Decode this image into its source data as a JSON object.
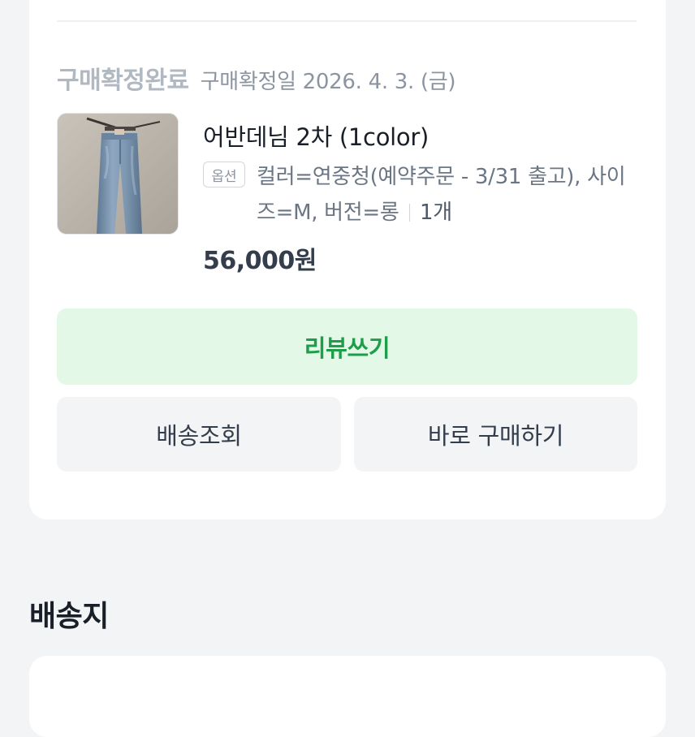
{
  "order": {
    "status_label": "구매확정완료",
    "confirm_date": "구매확정일 2026. 4. 3. (금)",
    "product": {
      "name": "어반데님 2차 (1color)",
      "image": "jeans-photo",
      "option_badge": "옵션",
      "option_text": "컬러=연중청(예약주문 - 3/31 출고), 사이즈=M, 버전=롱",
      "quantity": "1개",
      "price": "56,000원"
    },
    "buttons": {
      "review": "리뷰쓰기",
      "track_shipping": "배송조회",
      "buy_again": "바로 구매하기"
    }
  },
  "shipping_section": {
    "title": "배송지"
  },
  "colors": {
    "background": "#f2f4f6",
    "card": "#ffffff",
    "review_bg": "#e4f8e8",
    "review_text": "#1e9e4a",
    "secondary_button_bg": "#f2f4f6"
  }
}
